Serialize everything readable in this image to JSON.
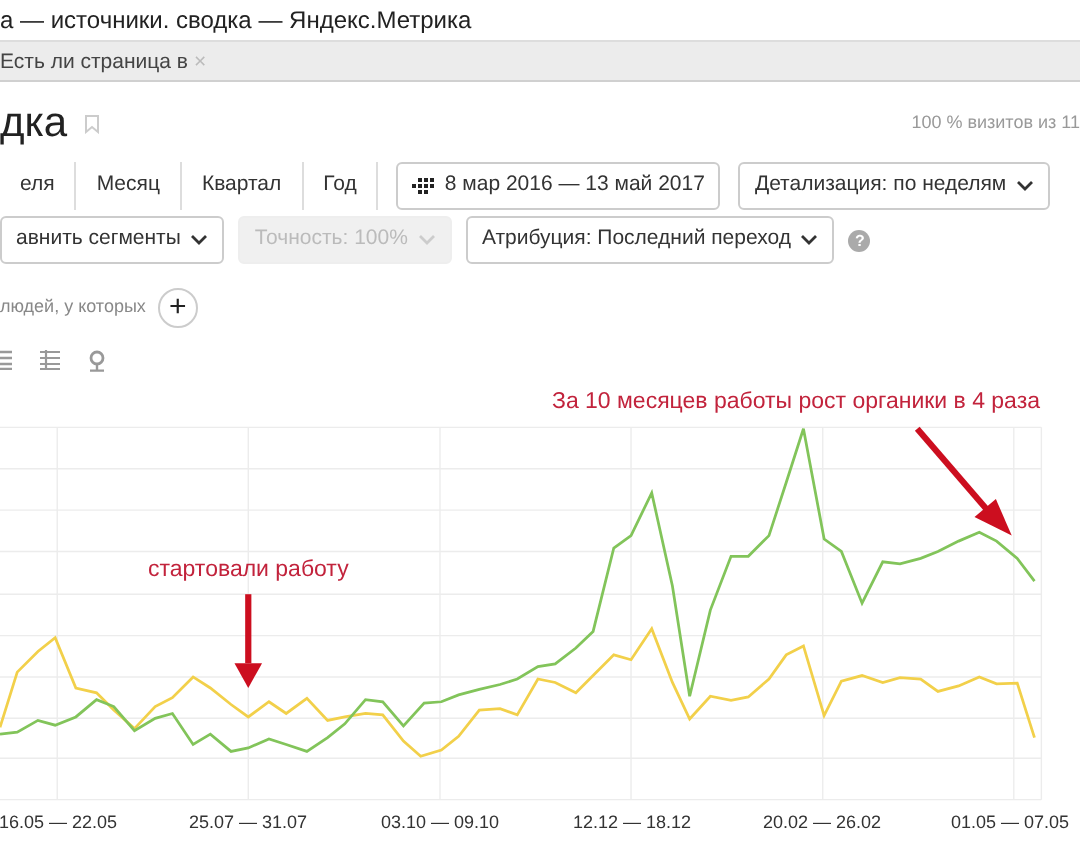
{
  "window": {
    "title": "а — источники. сводка — Яндекс.Метрика"
  },
  "browser_tab": {
    "title": "Есть ли страница в",
    "close": "×"
  },
  "page": {
    "title": "дка",
    "visits_note": "100 % визитов из 11"
  },
  "period_tabs": [
    {
      "label": "еля",
      "selected": false
    },
    {
      "label": "Месяц",
      "selected": false
    },
    {
      "label": "Квартал",
      "selected": false
    },
    {
      "label": "Год",
      "selected": false
    }
  ],
  "date_range": "8 мар 2016 — 13 май 2017",
  "detail": "Детализация: по неделям",
  "segment_controls": [
    {
      "label": "авнить сегменты",
      "disabled": false
    },
    {
      "label": "Точность: 100%",
      "disabled": true
    },
    {
      "label": "Атрибуция: Последний переход",
      "disabled": false
    }
  ],
  "help": "?",
  "filter": {
    "text": "людей, у которых",
    "add": "+"
  },
  "chart": {
    "annotations": [
      {
        "text": "стартовали работу"
      },
      {
        "text": "За 10 месяцев работы рост органики в 4 раза"
      }
    ],
    "x_labels": [
      "16.05 — 22.05",
      "25.07 — 31.07",
      "03.10 — 09.10",
      "12.12 — 18.12",
      "20.02 — 26.02",
      "01.05 — 07.05"
    ]
  }
}
